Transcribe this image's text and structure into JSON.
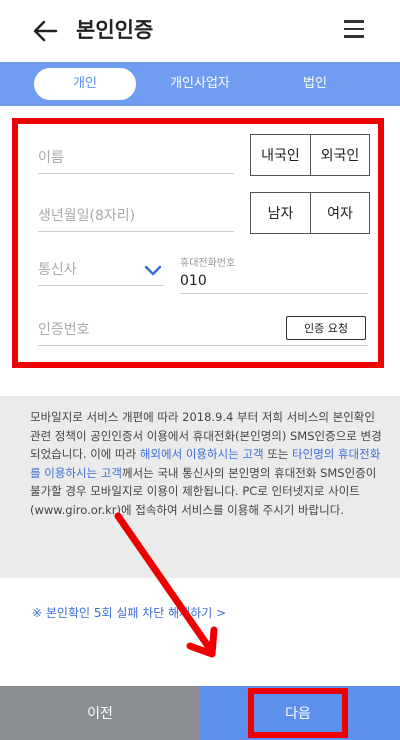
{
  "header": {
    "title": "본인인증"
  },
  "tabs": [
    {
      "label": "개인",
      "active": true
    },
    {
      "label": "개인사업자",
      "active": false
    },
    {
      "label": "법인",
      "active": false
    }
  ],
  "form": {
    "name_placeholder": "이름",
    "birth_placeholder": "생년월일(8자리)",
    "carrier_placeholder": "통신사",
    "phone_label": "휴대전화번호",
    "phone_value": "010",
    "cert_placeholder": "인증번호",
    "cert_request_label": "인증 요청",
    "nationality": {
      "options": [
        "내국인",
        "외국인"
      ]
    },
    "sex": {
      "options": [
        "남자",
        "여자"
      ]
    }
  },
  "notice": {
    "p1": "모바일지로 서비스 개편에 따라 2018.9.4 부터 저희 서비스의 본인확인 관련 정책이 공인인증서 이용에서 휴대전화(본인명의) SMS인증으로 변경되었습니다. 이에 따라 ",
    "hl1": "해외에서 이용하시는 고객",
    "p2": " 또는 ",
    "hl2": "타인명의 휴대전화를 이용하시는 고객",
    "p3": "께서는 국내 통신사의 본인명의 휴대전화 SMS인증이 불가할 경우 모바일지로 이용이 제한됩니다. PC로 인터넷지로 사이트(www.giro.or.kr)에 접속하여 서비스를 이용해 주시기 바랍니다."
  },
  "fail_link": "※ 본인확인 5회 실패 차단 해제하기 >",
  "bottom": {
    "prev_label": "이전",
    "next_label": "다음"
  },
  "colors": {
    "accent": "#5d8fec",
    "tabbar": "#6f9bf0",
    "highlight": "#ee0000",
    "prev": "#8a8d92"
  }
}
